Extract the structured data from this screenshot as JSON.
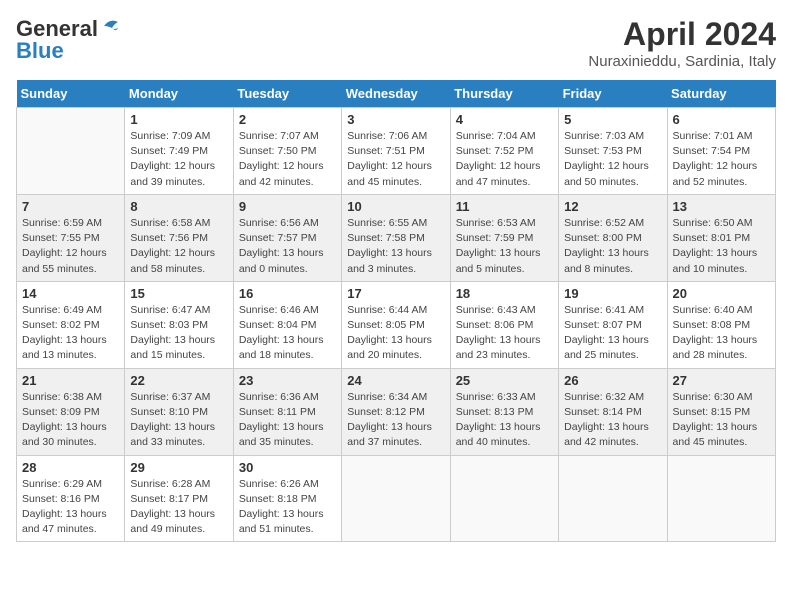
{
  "header": {
    "logo_general": "General",
    "logo_blue": "Blue",
    "month_title": "April 2024",
    "location": "Nuraxinieddu, Sardinia, Italy"
  },
  "weekdays": [
    "Sunday",
    "Monday",
    "Tuesday",
    "Wednesday",
    "Thursday",
    "Friday",
    "Saturday"
  ],
  "weeks": [
    [
      {
        "day": null
      },
      {
        "day": "1",
        "sunrise": "Sunrise: 7:09 AM",
        "sunset": "Sunset: 7:49 PM",
        "daylight": "Daylight: 12 hours and 39 minutes."
      },
      {
        "day": "2",
        "sunrise": "Sunrise: 7:07 AM",
        "sunset": "Sunset: 7:50 PM",
        "daylight": "Daylight: 12 hours and 42 minutes."
      },
      {
        "day": "3",
        "sunrise": "Sunrise: 7:06 AM",
        "sunset": "Sunset: 7:51 PM",
        "daylight": "Daylight: 12 hours and 45 minutes."
      },
      {
        "day": "4",
        "sunrise": "Sunrise: 7:04 AM",
        "sunset": "Sunset: 7:52 PM",
        "daylight": "Daylight: 12 hours and 47 minutes."
      },
      {
        "day": "5",
        "sunrise": "Sunrise: 7:03 AM",
        "sunset": "Sunset: 7:53 PM",
        "daylight": "Daylight: 12 hours and 50 minutes."
      },
      {
        "day": "6",
        "sunrise": "Sunrise: 7:01 AM",
        "sunset": "Sunset: 7:54 PM",
        "daylight": "Daylight: 12 hours and 52 minutes."
      }
    ],
    [
      {
        "day": "7",
        "sunrise": "Sunrise: 6:59 AM",
        "sunset": "Sunset: 7:55 PM",
        "daylight": "Daylight: 12 hours and 55 minutes."
      },
      {
        "day": "8",
        "sunrise": "Sunrise: 6:58 AM",
        "sunset": "Sunset: 7:56 PM",
        "daylight": "Daylight: 12 hours and 58 minutes."
      },
      {
        "day": "9",
        "sunrise": "Sunrise: 6:56 AM",
        "sunset": "Sunset: 7:57 PM",
        "daylight": "Daylight: 13 hours and 0 minutes."
      },
      {
        "day": "10",
        "sunrise": "Sunrise: 6:55 AM",
        "sunset": "Sunset: 7:58 PM",
        "daylight": "Daylight: 13 hours and 3 minutes."
      },
      {
        "day": "11",
        "sunrise": "Sunrise: 6:53 AM",
        "sunset": "Sunset: 7:59 PM",
        "daylight": "Daylight: 13 hours and 5 minutes."
      },
      {
        "day": "12",
        "sunrise": "Sunrise: 6:52 AM",
        "sunset": "Sunset: 8:00 PM",
        "daylight": "Daylight: 13 hours and 8 minutes."
      },
      {
        "day": "13",
        "sunrise": "Sunrise: 6:50 AM",
        "sunset": "Sunset: 8:01 PM",
        "daylight": "Daylight: 13 hours and 10 minutes."
      }
    ],
    [
      {
        "day": "14",
        "sunrise": "Sunrise: 6:49 AM",
        "sunset": "Sunset: 8:02 PM",
        "daylight": "Daylight: 13 hours and 13 minutes."
      },
      {
        "day": "15",
        "sunrise": "Sunrise: 6:47 AM",
        "sunset": "Sunset: 8:03 PM",
        "daylight": "Daylight: 13 hours and 15 minutes."
      },
      {
        "day": "16",
        "sunrise": "Sunrise: 6:46 AM",
        "sunset": "Sunset: 8:04 PM",
        "daylight": "Daylight: 13 hours and 18 minutes."
      },
      {
        "day": "17",
        "sunrise": "Sunrise: 6:44 AM",
        "sunset": "Sunset: 8:05 PM",
        "daylight": "Daylight: 13 hours and 20 minutes."
      },
      {
        "day": "18",
        "sunrise": "Sunrise: 6:43 AM",
        "sunset": "Sunset: 8:06 PM",
        "daylight": "Daylight: 13 hours and 23 minutes."
      },
      {
        "day": "19",
        "sunrise": "Sunrise: 6:41 AM",
        "sunset": "Sunset: 8:07 PM",
        "daylight": "Daylight: 13 hours and 25 minutes."
      },
      {
        "day": "20",
        "sunrise": "Sunrise: 6:40 AM",
        "sunset": "Sunset: 8:08 PM",
        "daylight": "Daylight: 13 hours and 28 minutes."
      }
    ],
    [
      {
        "day": "21",
        "sunrise": "Sunrise: 6:38 AM",
        "sunset": "Sunset: 8:09 PM",
        "daylight": "Daylight: 13 hours and 30 minutes."
      },
      {
        "day": "22",
        "sunrise": "Sunrise: 6:37 AM",
        "sunset": "Sunset: 8:10 PM",
        "daylight": "Daylight: 13 hours and 33 minutes."
      },
      {
        "day": "23",
        "sunrise": "Sunrise: 6:36 AM",
        "sunset": "Sunset: 8:11 PM",
        "daylight": "Daylight: 13 hours and 35 minutes."
      },
      {
        "day": "24",
        "sunrise": "Sunrise: 6:34 AM",
        "sunset": "Sunset: 8:12 PM",
        "daylight": "Daylight: 13 hours and 37 minutes."
      },
      {
        "day": "25",
        "sunrise": "Sunrise: 6:33 AM",
        "sunset": "Sunset: 8:13 PM",
        "daylight": "Daylight: 13 hours and 40 minutes."
      },
      {
        "day": "26",
        "sunrise": "Sunrise: 6:32 AM",
        "sunset": "Sunset: 8:14 PM",
        "daylight": "Daylight: 13 hours and 42 minutes."
      },
      {
        "day": "27",
        "sunrise": "Sunrise: 6:30 AM",
        "sunset": "Sunset: 8:15 PM",
        "daylight": "Daylight: 13 hours and 45 minutes."
      }
    ],
    [
      {
        "day": "28",
        "sunrise": "Sunrise: 6:29 AM",
        "sunset": "Sunset: 8:16 PM",
        "daylight": "Daylight: 13 hours and 47 minutes."
      },
      {
        "day": "29",
        "sunrise": "Sunrise: 6:28 AM",
        "sunset": "Sunset: 8:17 PM",
        "daylight": "Daylight: 13 hours and 49 minutes."
      },
      {
        "day": "30",
        "sunrise": "Sunrise: 6:26 AM",
        "sunset": "Sunset: 8:18 PM",
        "daylight": "Daylight: 13 hours and 51 minutes."
      },
      {
        "day": null
      },
      {
        "day": null
      },
      {
        "day": null
      },
      {
        "day": null
      }
    ]
  ]
}
